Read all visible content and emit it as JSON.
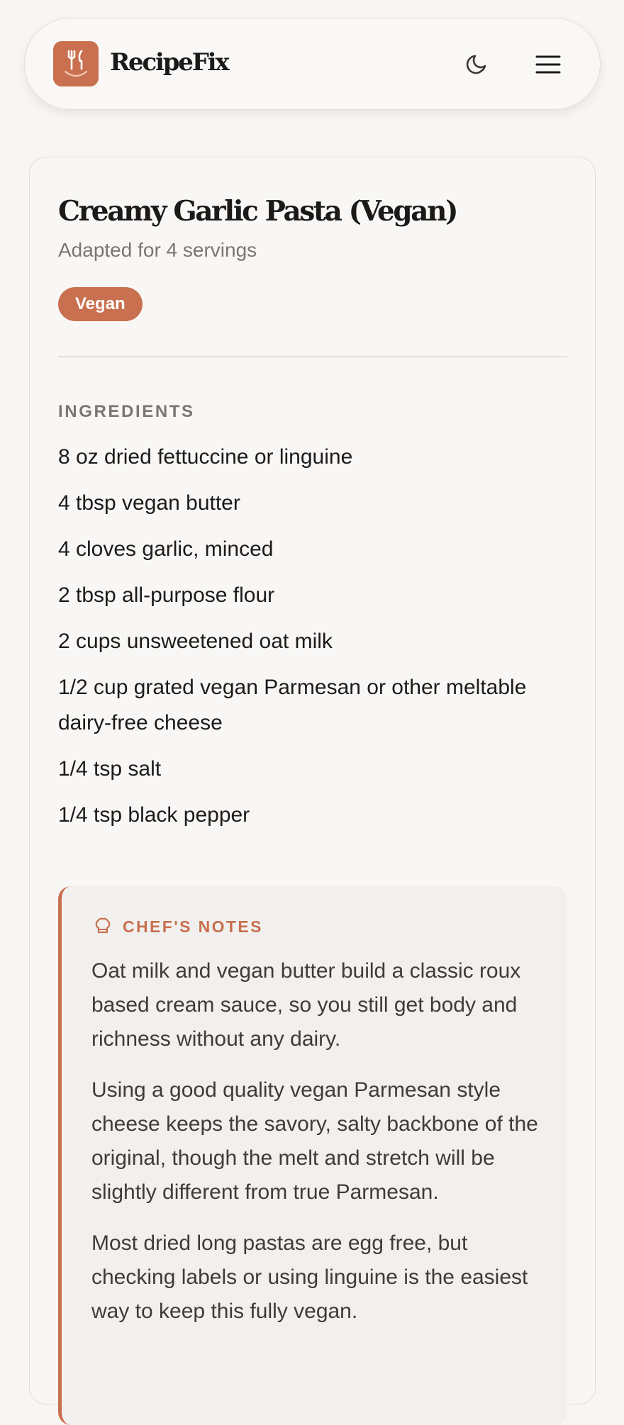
{
  "header": {
    "brand": "RecipeFix",
    "logo_icon": "fork-knife-smile-icon",
    "theme_toggle_icon": "moon-icon",
    "menu_icon": "hamburger-menu-icon"
  },
  "recipe": {
    "title": "Creamy Garlic Pasta (Vegan)",
    "subtitle": "Adapted for 4 servings",
    "tag": "Vegan",
    "ingredients_heading": "INGREDIENTS",
    "ingredients": [
      "8 oz dried fettuccine or linguine",
      "4 tbsp vegan butter",
      "4 cloves garlic, minced",
      "2 tbsp all-purpose flour",
      "2 cups unsweetened oat milk",
      "1/2 cup grated vegan Parmesan or other meltable dairy-free cheese",
      "1/4 tsp salt",
      "1/4 tsp black pepper"
    ]
  },
  "notes": {
    "icon": "chef-hat-icon",
    "title": "CHEF'S NOTES",
    "paragraphs": [
      "Oat milk and vegan butter build a classic roux based cream sauce, so you still get body and richness without any dairy.",
      "Using a good quality vegan Parmesan style cheese keeps the savory, salty backbone of the original, though the melt and stretch will be slightly different from true Parmesan.",
      "Most dried long pastas are egg free, but checking labels or using linguine is the easiest way to keep this fully vegan."
    ]
  },
  "colors": {
    "accent": "#c8704f",
    "background": "#f8f6f4",
    "notes_background": "#f2f0ee",
    "muted_text": "#7a7672"
  }
}
